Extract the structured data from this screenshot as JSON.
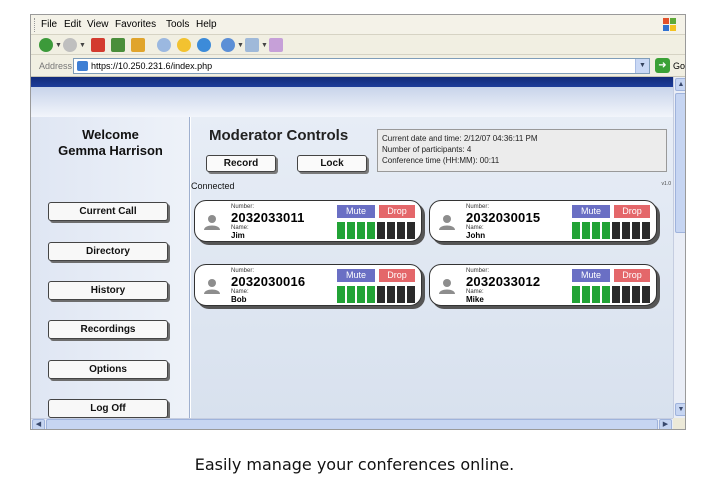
{
  "browser": {
    "menu": [
      "File",
      "Edit",
      "View",
      "Favorites",
      "Tools",
      "Help"
    ],
    "address_label": "Address",
    "url": "https://10.250.231.6/index.php",
    "go_label": "Go"
  },
  "sidebar": {
    "welcome_line1": "Welcome",
    "welcome_line2": "Gemma Harrison",
    "items": [
      {
        "label": "Current Call"
      },
      {
        "label": "Directory"
      },
      {
        "label": "History"
      },
      {
        "label": "Recordings"
      },
      {
        "label": "Options"
      },
      {
        "label": "Log Off"
      }
    ]
  },
  "main": {
    "title": "Moderator Controls",
    "record_label": "Record",
    "lock_label": "Lock",
    "info": {
      "datetime": "Current date and time:  2/12/07 04:36:11 PM",
      "participants": "Number of participants:  4",
      "conference_time": "Conference time (HH:MM):  00:11"
    },
    "connected_label": "Connected",
    "version": "v1.0",
    "number_label": "Number:",
    "name_label": "Name:",
    "mute_label": "Mute",
    "drop_label": "Drop",
    "participants": [
      {
        "number": "2032033011",
        "name": "Jim",
        "level": 0.5
      },
      {
        "number": "2032030015",
        "name": "John",
        "level": 0.5
      },
      {
        "number": "2032030016",
        "name": "Bob",
        "level": 0.5
      },
      {
        "number": "2032033012",
        "name": "Mike",
        "level": 0.5
      }
    ]
  },
  "caption": "Easily manage your conferences online.",
  "colors": {
    "mute": "#6a6fc4",
    "drop": "#e4676a",
    "meter_on": "#22a336",
    "meter_off": "#2a2a2a",
    "header_band": "#1d3d9a"
  }
}
